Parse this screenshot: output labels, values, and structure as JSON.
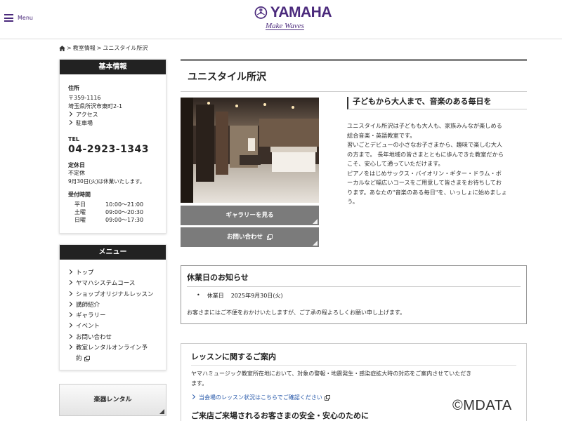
{
  "header": {
    "menu_label": "Menu",
    "logo_text": "YAMAHA",
    "tagline": "Make Waves"
  },
  "breadcrumb": {
    "home_icon": "home-icon",
    "items": [
      "教室情報",
      "ユニスタイル所沢"
    ],
    "separator": ">"
  },
  "sidebar": {
    "basic_info": {
      "heading": "基本情報",
      "address_label": "住所",
      "postal": "〒359-1116",
      "address": "埼玉県所沢市東町2-1",
      "links": [
        "アクセス",
        "駐車場"
      ],
      "tel_label": "TEL",
      "tel": "04-2923-1343",
      "holiday_label": "定休日",
      "holiday": "不定休",
      "holiday_note": "9月30日(火)は休業いたします。",
      "hours_label": "受付時間",
      "hours": [
        {
          "day": "平日",
          "time": "10:00〜21:00"
        },
        {
          "day": "土曜",
          "time": "09:00〜20:30"
        },
        {
          "day": "日曜",
          "time": "09:00〜17:30"
        }
      ]
    },
    "menu": {
      "heading": "メニュー",
      "items": [
        "トップ",
        "ヤマハシステムコース",
        "ショップオリジナルレッスン",
        "講師紹介",
        "ギャラリー",
        "イベント",
        "お問い合わせ",
        "教室レンタルオンライン予約"
      ]
    },
    "rental_button": "楽器レンタル"
  },
  "main": {
    "page_title": "ユニスタイル所沢",
    "gallery_button": "ギャラリーを見る",
    "contact_button": "お問い合わせ",
    "intro_heading": "子どもから大人まで、音楽のある毎日を",
    "intro_lines": [
      "ユニスタイル所沢は子どもも大人も、家族みんなが楽しめる",
      "総合音楽・英語教室です。",
      "習いごとデビューの小さなお子さまから、趣味で楽しむ大人",
      "の方まで。 長年地域の皆さまとともに歩んできた教室だから",
      "こそ、安心して通っていただけます。",
      "ピアノをはじめサックス・バイオリン・ギター・ドラム・ボ",
      "ーカルなど幅広いコースをご用意して皆さまをお待ちしてお",
      "ります。あなたの\"音楽のある毎日\"を、いっしょに始めましょ",
      "う。"
    ],
    "notice": {
      "heading": "休業日のお知らせ",
      "bullet_label": "休業日",
      "bullet_date": "2025年9月30日(火)",
      "text": "お客さまにはご不便をおかけいたしますが、ご了承の程よろしくお願い申し上げます。"
    },
    "lesson": {
      "heading": "レッスンに関するご案内",
      "text_line1": "ヤマハミュージック教室所在地において、対象の警報・地震発生・感染症拡大時の対応をご案内させていただき",
      "text_line2": "ます。",
      "link": "当会場のレッスン状況はこちらでご確認ください",
      "subheading": "ご来店ご来場されるお客さまの安全・安心のために"
    }
  },
  "watermark": "©MDATA",
  "colors": {
    "brand": "#4b2a7c",
    "link": "#2456a8",
    "button_gray": "#7b7b7b"
  }
}
